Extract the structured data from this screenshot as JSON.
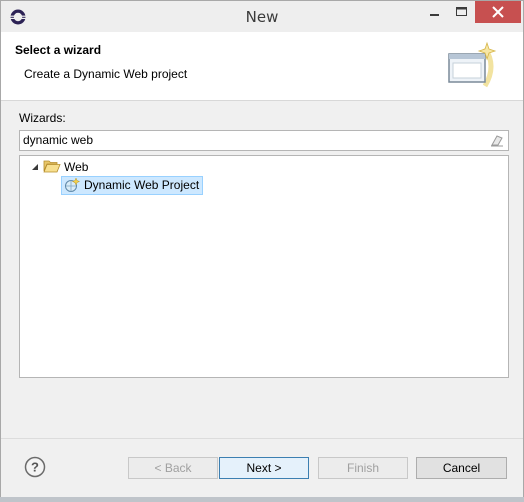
{
  "window": {
    "title": "New",
    "app_icon": "eclipse-icon",
    "controls": [
      "minimize-icon",
      "maximize-icon",
      "close-icon"
    ]
  },
  "header": {
    "title": "Select a wizard",
    "description": "Create a Dynamic Web project",
    "graphic": "wizard-banner-icon"
  },
  "wizards": {
    "label": "Wizards:",
    "filter_value": "dynamic web",
    "clear_icon": "eraser-icon"
  },
  "tree": {
    "nodes": [
      {
        "label": "Web",
        "icon": "folder-open-icon",
        "expanded": true
      },
      {
        "label": "Dynamic Web Project",
        "icon": "dynamic-web-project-icon",
        "selected": true
      }
    ]
  },
  "buttons": {
    "help_icon": "help-icon",
    "back": "< Back",
    "next": "Next >",
    "finish": "Finish",
    "cancel": "Cancel"
  },
  "colors": {
    "close_button": "#c75050",
    "selection_bg": "#cde8ff",
    "selection_border": "#99d1ff",
    "default_button_border": "#3c7fb1"
  }
}
